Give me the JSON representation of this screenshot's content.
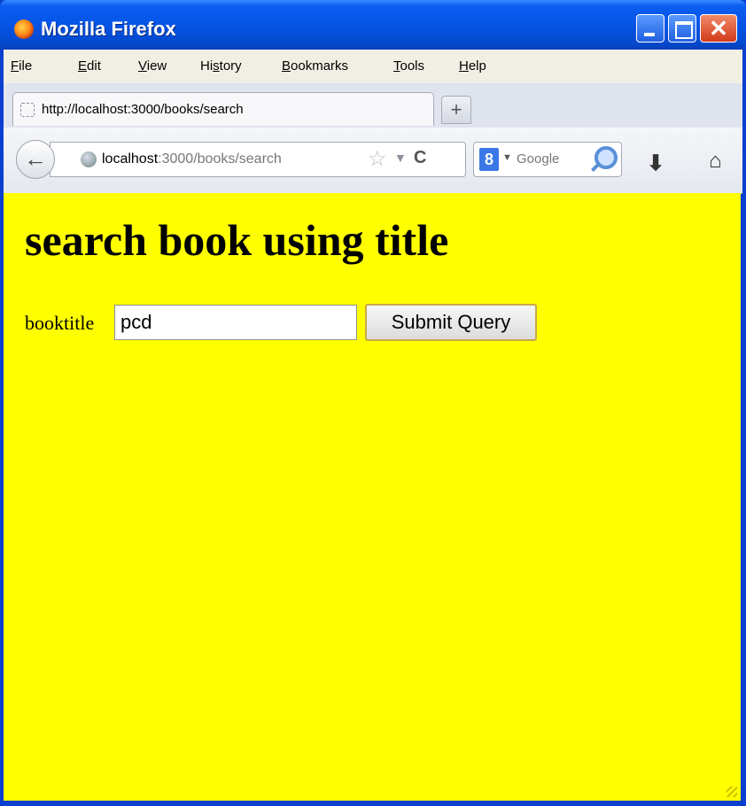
{
  "window": {
    "title": "Mozilla Firefox",
    "close_glyph": "✕"
  },
  "menubar": {
    "items": [
      {
        "pre": "",
        "key": "F",
        "post": "ile"
      },
      {
        "pre": "",
        "key": "E",
        "post": "dit"
      },
      {
        "pre": "",
        "key": "V",
        "post": "iew"
      },
      {
        "pre": "Hi",
        "key": "s",
        "post": "tory"
      },
      {
        "pre": "",
        "key": "B",
        "post": "ookmarks"
      },
      {
        "pre": "",
        "key": "T",
        "post": "ools"
      },
      {
        "pre": "",
        "key": "H",
        "post": "elp"
      }
    ]
  },
  "tabs": {
    "active_title": "http://localhost:3000/books/search",
    "new_tab_glyph": "+"
  },
  "navbar": {
    "back_glyph": "←",
    "url_host": "localhost",
    "url_path": ":3000/books/search",
    "star_glyph": "☆",
    "dropdown_glyph": "▼",
    "reload_glyph": "C",
    "search_badge": "8",
    "search_drop_glyph": "▼",
    "search_engine": "Google",
    "download_glyph": "⬇",
    "home_glyph": "⌂"
  },
  "page": {
    "heading": "search book using title",
    "field_label": "booktitle",
    "field_value": "pcd",
    "submit_label": "Submit Query",
    "background_color": "#ffff00"
  }
}
